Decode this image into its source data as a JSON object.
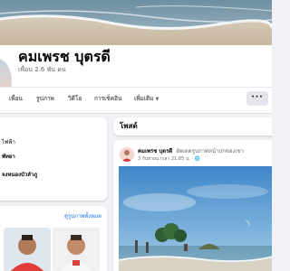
{
  "profile": {
    "name": "คมเพรช บุตรดี",
    "friends_count": "เพื่อน 2.6 พัน คน"
  },
  "tabs": [
    {
      "label": "เพื่อน"
    },
    {
      "label": "รูปภาพ"
    },
    {
      "label": "วิดีโอ"
    },
    {
      "label": "การเช็คอิน"
    },
    {
      "label": "เพิ่มเติม"
    }
  ],
  "more_button_label": "···",
  "intro": {
    "lines": [
      {
        "text": "ไฟฟ้า"
      },
      {
        "text": "พัทยา"
      },
      {
        "text": "จงหนองบัวลำภู"
      }
    ]
  },
  "photos": {
    "see_all_label": "ดูรูปภาพทั้งหมด"
  },
  "posts": {
    "title": "โพสต์",
    "items": [
      {
        "author": "คมเพรช บุตรดี",
        "action": "อัพเดตรูปภาพหน้าปกของเขา",
        "meta": "3 กันยายน เวลา 21:05 น. · 🌐"
      }
    ]
  },
  "colors": {
    "background": "#f0f2f5",
    "link": "#1877f2",
    "secondary_text": "#65676b"
  },
  "icons": {
    "more": "ellipsis-icon",
    "caret": "chevron-down-icon",
    "audience": "globe-icon"
  }
}
